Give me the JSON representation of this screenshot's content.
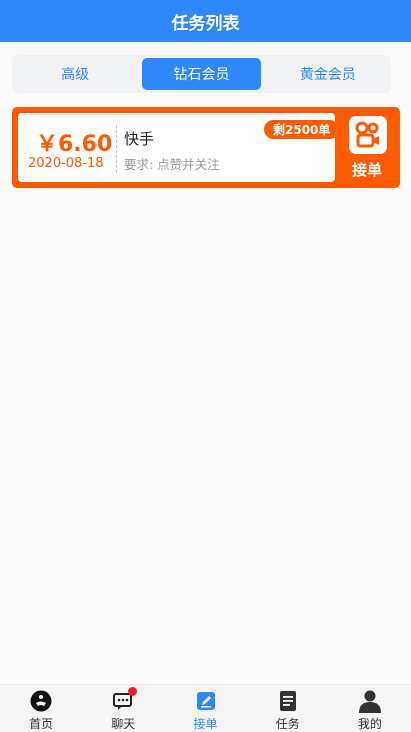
{
  "header": {
    "title": "任务列表"
  },
  "tabs": [
    {
      "label": "高级",
      "active": false
    },
    {
      "label": "钻石会员",
      "active": true
    },
    {
      "label": "黄金会员",
      "active": false
    }
  ],
  "tasks": [
    {
      "price": "￥6.60",
      "date": "2020-08-18",
      "name": "快手",
      "requirement": "要求: 点赞并关注",
      "remaining": "剩2500单",
      "app_icon": "kuaishou-icon",
      "action_label": "接单"
    }
  ],
  "tabbar": [
    {
      "label": "首页",
      "icon": "home-logo-icon",
      "active": false
    },
    {
      "label": "聊天",
      "icon": "chat-icon",
      "active": false,
      "has_badge": true
    },
    {
      "label": "接单",
      "icon": "edit-icon",
      "active": true
    },
    {
      "label": "任务",
      "icon": "document-icon",
      "active": false
    },
    {
      "label": "我的",
      "icon": "user-icon",
      "active": false
    }
  ],
  "colors": {
    "primary": "#2f88fb",
    "accent": "#ff5a00",
    "badge": "#ff1a1a"
  }
}
